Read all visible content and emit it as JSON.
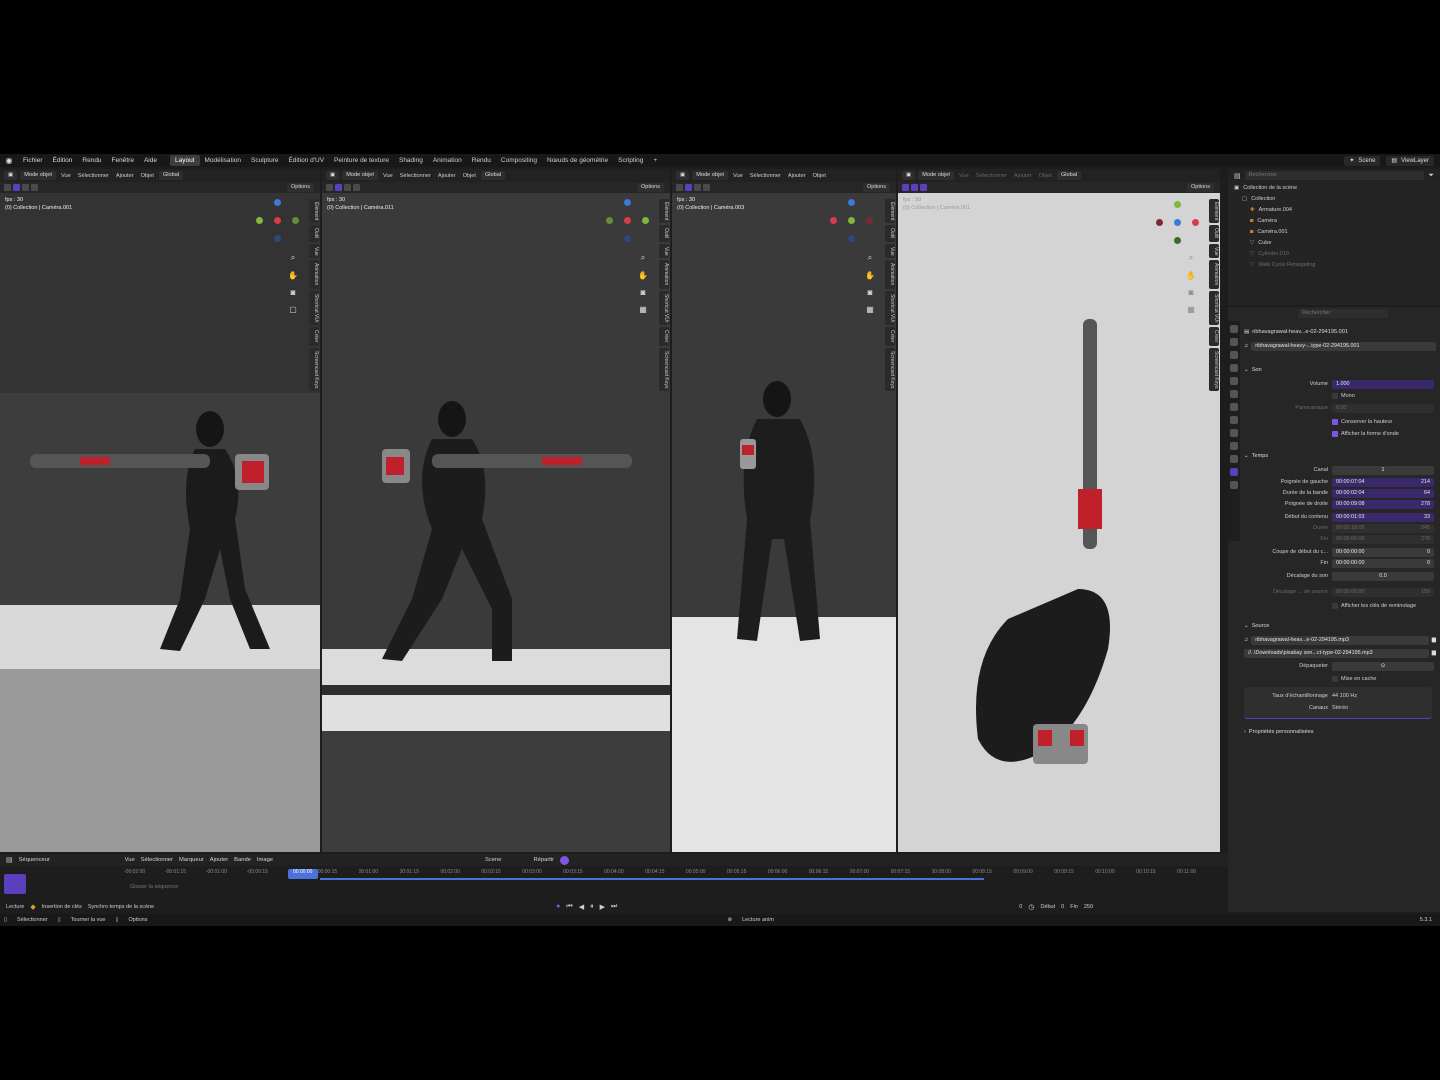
{
  "menu": [
    "Fichier",
    "Édition",
    "Rendu",
    "Fenêtre",
    "Aide"
  ],
  "workspaces": [
    "Layout",
    "Modélisation",
    "Sculpture",
    "Édition d'UV",
    "Peinture de texture",
    "Shading",
    "Animation",
    "Rendu",
    "Compositing",
    "Nœuds de géométrie",
    "Scripting"
  ],
  "active_workspace": "Layout",
  "add_tab": "+",
  "scene": {
    "name": "Scene",
    "view_layer": "ViewLayer"
  },
  "viewports": [
    {
      "mode": "Mode objet",
      "menus": [
        "Vue",
        "Sélectionner",
        "Ajouter",
        "Objet"
      ],
      "orientation": "Global",
      "options": "Options",
      "fps": "fps : 30",
      "caption": "(0) Collection | Caméra.001",
      "tabs": [
        "Élément",
        "Outil",
        "Vue",
        "Animation",
        "Shortcut VUr",
        "Créer",
        "Screencast Keys"
      ]
    },
    {
      "mode": "Mode objet",
      "menus": [
        "Vue",
        "Sélectionner",
        "Ajouter",
        "Objet"
      ],
      "orientation": "Global",
      "options": "Options",
      "fps": "fps : 30",
      "caption": "(0) Collection | Caméra.011",
      "tabs": [
        "Élément",
        "Outil",
        "Vue",
        "Animation",
        "Shortcut VUr",
        "Créer",
        "Screencast Keys"
      ]
    },
    {
      "mode": "Mode objet",
      "menus": [
        "Vue",
        "Sélectionner",
        "Ajouter",
        "Objet"
      ],
      "orientation": "Global",
      "options": "Options",
      "fps": "fps : 30",
      "caption": "(0) Collection | Caméra.003",
      "tabs": [
        "Élément",
        "Outil",
        "Vue",
        "Animation",
        "Shortcut VUr",
        "Créer",
        "Screencast Keys"
      ]
    },
    {
      "mode": "Mode objet",
      "menus": [
        "Vue",
        "Sélectionner",
        "Ajouter",
        "Objet"
      ],
      "orientation": "Global",
      "options": "Options",
      "fps": "fps : 30",
      "caption": "(0) Collection | Caméra.001",
      "tabs": [
        "Élément",
        "Outil",
        "Vue",
        "Animation",
        "Shortcut VUr",
        "Créer",
        "Screencast Keys"
      ]
    }
  ],
  "outliner": {
    "search_placeholder": "Rechercher",
    "root": "Collection de la scène",
    "items": [
      {
        "name": "Collection",
        "dim": false
      },
      {
        "name": "Armature.004",
        "dim": false
      },
      {
        "name": "Caméra",
        "dim": false
      },
      {
        "name": "Caméra.001",
        "dim": false
      },
      {
        "name": "Cube",
        "dim": false
      },
      {
        "name": "Cylinder.010",
        "dim": true
      },
      {
        "name": "Walk Cycle Retargeting",
        "dim": true
      }
    ]
  },
  "properties": {
    "search_placeholder": "Rechercher",
    "breadcrumb": "ribhavagrawal-heav...e-02-294195.001",
    "strip_name": "ribhavagrawal-heavy-...type-02-294195.001",
    "sound_section": "Son",
    "volume_label": "Volume",
    "volume": "1.000",
    "mono": "Mono",
    "panoramique_label": "Panoramique",
    "panoramique": "0.00",
    "keep_pitch": "Conserver la hauteur",
    "show_wave": "Afficher la forme d'onde",
    "time_section": "Temps",
    "channel_label": "Canal",
    "channel": "1",
    "time_rows": [
      {
        "label": "Poignée de gauche",
        "value": "00:00:07:04",
        "frame": "214",
        "dim": false
      },
      {
        "label": "Durée de la bande",
        "value": "00:00:02:04",
        "frame": "64",
        "dim": false
      },
      {
        "label": "Poignée de droite",
        "value": "00:00:09:08",
        "frame": "278",
        "dim": false
      },
      {
        "label": "Début du contenu",
        "value": "00:00:01:03",
        "frame": "33",
        "dim": false
      },
      {
        "label": "Durée",
        "value": "00:00:18:05",
        "frame": "545",
        "dim": true
      },
      {
        "label": "Fin",
        "value": "00:00:09:08",
        "frame": "278",
        "dim": true
      },
      {
        "label": "Coupe de début du c...",
        "value": "00:00:00:00",
        "frame": "0",
        "dim": false
      },
      {
        "label": "Fin",
        "value": "00:00:00:00",
        "frame": "0",
        "dim": false
      }
    ],
    "sound_offset_label": "Décalage du son",
    "sound_offset": "0.0",
    "offset_label": "Décalage ... de source",
    "offset": "00:00:00:00",
    "offset_frame": "150",
    "show_retiming": "Afficher les clés de reminutage",
    "source_section": "Source",
    "source_name": "ribhavagrawal-heav...e-02-294195.mp3",
    "source_path": "//..\\Downloads\\pixabay son...ct-type-02-294195.mp3",
    "unpack": "Dépaqueter",
    "cache": "Mise en cache",
    "samplerate_label": "Taux d'échantillonnage",
    "samplerate": "44 100 Hz",
    "channels_label": "Canaux",
    "channels": "Stéréo",
    "custom_props": "Propriétés personnalisées"
  },
  "sequencer": {
    "editor": "Séquenceur",
    "menus": [
      "Vue",
      "Sélectionner",
      "Marqueur",
      "Ajouter",
      "Bande",
      "Image"
    ],
    "scene": "Scene",
    "snap": "Répartir",
    "ruler": [
      "-00:02:00",
      "-00:01:15",
      "-00:01:00",
      "-00:00:15",
      "00:00:00",
      "00:00:15",
      "00:01:00",
      "00:01:15",
      "00:02:00",
      "00:02:15",
      "00:03:00",
      "00:03:15",
      "00:04:00",
      "00:04:15",
      "00:05:00",
      "00:05:15",
      "00:06:00",
      "00:06:15",
      "00:07:00",
      "00:07:15",
      "00:08:00",
      "00:08:15",
      "00:09:00",
      "00:09:15",
      "00:10:00",
      "00:10:15",
      "00:11:00"
    ],
    "current_time": "00:00:00",
    "drop_hint": "Glisser la séquence",
    "playback": "Lecture",
    "keying": "Insertion de clés",
    "sync": "Synchro temps de la scène",
    "frame": "0",
    "start_label": "Début",
    "start": "0",
    "end_label": "Fin",
    "end": "250"
  },
  "status": {
    "select": "Sélectionner",
    "rotate": "Tourner la vue",
    "options": "Options",
    "playback": "Lecture anim",
    "version": "5.3.1"
  }
}
